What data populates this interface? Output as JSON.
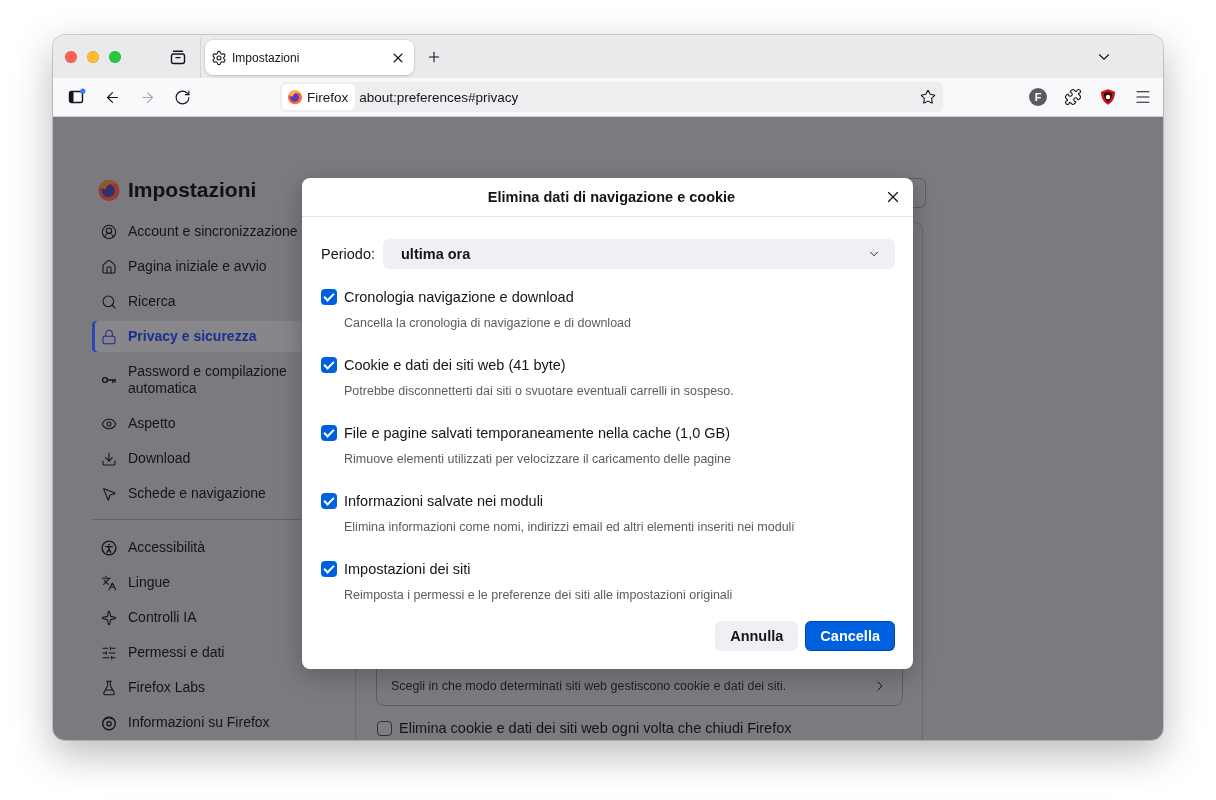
{
  "tabs": [
    {
      "label": "Impostazioni",
      "selected": true
    }
  ],
  "toolbar": {
    "nav": [
      {
        "kind": "back",
        "disabled": false
      },
      {
        "kind": "forward",
        "disabled": true
      },
      {
        "kind": "reload",
        "disabled": false
      }
    ],
    "identity": "Firefox",
    "url": "about:preferences#privacy",
    "avatar": "F"
  },
  "sidebar": {
    "title": "Impostazioni",
    "groups": [
      {
        "items": [
          {
            "label": "Account e sincronizzazione",
            "selected": false
          },
          {
            "label": "Pagina iniziale e avvio",
            "selected": false
          },
          {
            "label": "Ricerca",
            "selected": false
          },
          {
            "label": "Privacy e sicurezza",
            "selected": true
          },
          {
            "label": "Password e compilazione automatica",
            "selected": false
          },
          {
            "label": "Aspetto",
            "selected": false
          },
          {
            "label": "Download",
            "selected": false
          },
          {
            "label": "Schede e navigazione",
            "selected": false
          }
        ]
      },
      {
        "items": [
          {
            "label": "Accessibilità",
            "selected": false
          },
          {
            "label": "Lingue",
            "selected": false
          },
          {
            "label": "Controlli IA",
            "selected": false
          },
          {
            "label": "Permessi e dati",
            "selected": false
          },
          {
            "label": "Firefox Labs",
            "selected": false
          },
          {
            "label": "Informazioni su Firefox",
            "selected": false
          }
        ]
      }
    ]
  },
  "main": {
    "exceptions": {
      "description": "Scegli in che modo determinati siti web gestiscono cookie e dati dei siti."
    },
    "delete_on_close": {
      "label": "Elimina cookie e dati dei siti web ogni volta che chiudi Firefox",
      "checked": false
    }
  },
  "dialog": {
    "title": "Elimina dati di navigazione e cookie",
    "period": {
      "label": "Periodo:",
      "value": "ultima ora"
    },
    "options": [
      {
        "label": "Cronologia navigazione e download",
        "description": "Cancella la cronologia di navigazione e di download",
        "checked": true
      },
      {
        "label": "Cookie e dati dei siti web (41 byte)",
        "description": "Potrebbe disconnetterti dai siti o svuotare eventuali carrelli in sospeso.",
        "checked": true
      },
      {
        "label": "File e pagine salvati temporaneamente nella cache (1,0 GB)",
        "description": "Rimuove elementi utilizzati per velocizzare il caricamento delle pagine",
        "checked": true
      },
      {
        "label": "Informazioni salvate nei moduli",
        "description": "Elimina informazioni come nomi, indirizzi email ed altri elementi inseriti nei moduli",
        "checked": true
      },
      {
        "label": "Impostazioni dei siti",
        "description": "Reimposta i permessi e le preferenze dei siti alle impostazioni originali",
        "checked": true
      }
    ],
    "buttons": [
      {
        "label": "Annulla",
        "kind": "secondary",
        "focused": false
      },
      {
        "label": "Cancella",
        "kind": "primary",
        "focused": true
      }
    ]
  }
}
